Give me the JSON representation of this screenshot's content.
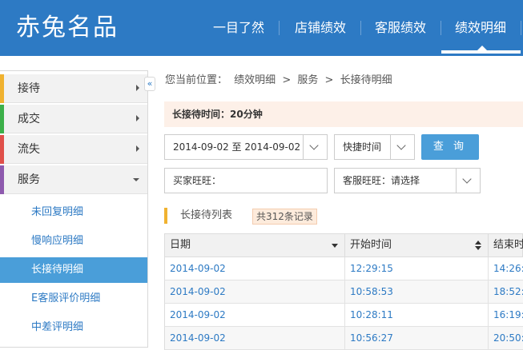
{
  "header": {
    "logo": "赤兔名品",
    "nav": [
      {
        "label": "一目了然"
      },
      {
        "label": "店铺绩效"
      },
      {
        "label": "客服绩效"
      },
      {
        "label": "绩效明细",
        "active": true
      }
    ]
  },
  "sidebar": {
    "collapse_glyph": "«",
    "categories": [
      {
        "label": "接待",
        "color": "#f0b230",
        "expanded": false
      },
      {
        "label": "成交",
        "color": "#3cb04a",
        "expanded": false
      },
      {
        "label": "流失",
        "color": "#e0504a",
        "expanded": false
      },
      {
        "label": "服务",
        "color": "#8e5aae",
        "expanded": true
      }
    ],
    "sub_items": [
      {
        "label": "未回复明细"
      },
      {
        "label": "慢响应明细"
      },
      {
        "label": "长接待明细",
        "active": true
      },
      {
        "label": "E客服评价明细"
      },
      {
        "label": "中差评明细"
      }
    ]
  },
  "breadcrumb": {
    "prefix": "您当前位置：",
    "items": [
      "绩效明细",
      "服务",
      "长接待明细"
    ],
    "separator": ">"
  },
  "notice": "长接待时间：20分钟",
  "filters": {
    "date_range": "2014-09-02 至 2014-09-02",
    "quick_time": "快捷时间",
    "query_button": "查 询",
    "buyer_label": "买家旺旺：",
    "service_label": "客服旺旺：请选择"
  },
  "list": {
    "title": "长接待列表",
    "count_badge": "共312条记录"
  },
  "table": {
    "columns": [
      "日期",
      "开始时间",
      "结束时"
    ],
    "rows": [
      [
        "2014-09-02",
        "12:29:15",
        "14:26:"
      ],
      [
        "2014-09-02",
        "10:58:53",
        "18:52:"
      ],
      [
        "2014-09-02",
        "10:28:11",
        "16:19:"
      ],
      [
        "2014-09-02",
        "10:56:27",
        "20:50:"
      ]
    ]
  },
  "colors": {
    "brand_blue": "#2d7ac4",
    "active_blue": "#4a9ed9"
  }
}
